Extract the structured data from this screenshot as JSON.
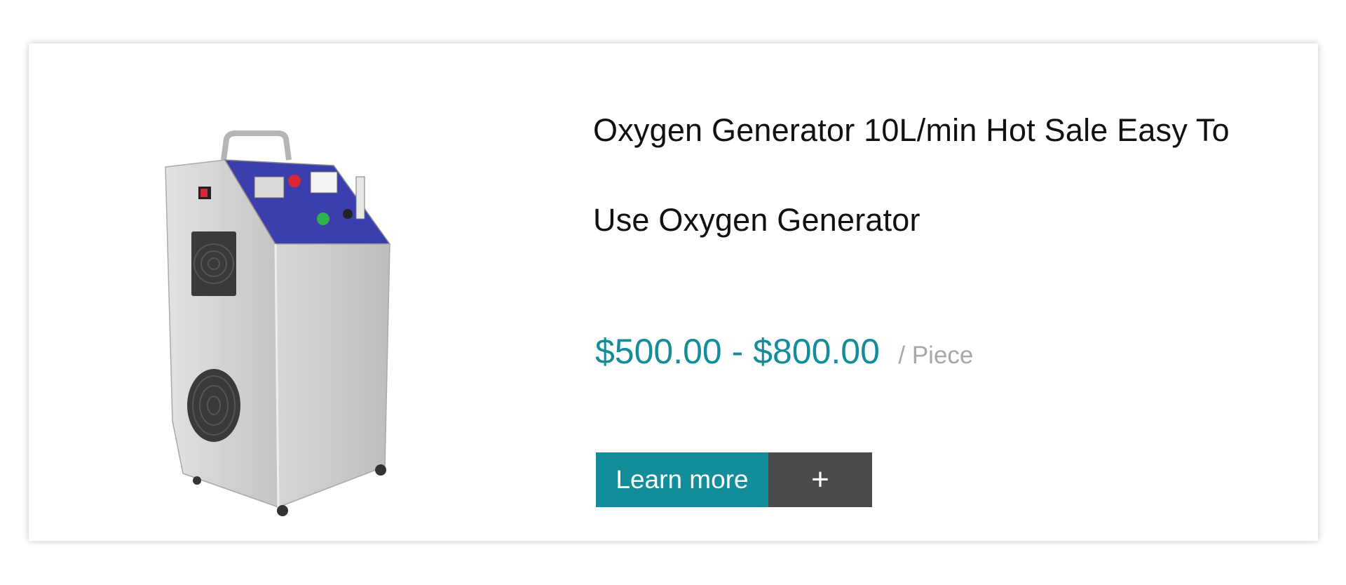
{
  "product": {
    "title": "Oxygen Generator 10L/min Hot Sale Easy To Use Oxygen Generator",
    "price_range": "$500.00 - $800.00",
    "unit": "/ Piece",
    "learn_more_label": "Learn more",
    "add_label": "+",
    "image_alt": "oxygen generator cabinet with blue control panel"
  },
  "colors": {
    "accent": "#138d9a",
    "secondary_button": "#4b4b4b",
    "panel_blue": "#3b3fae"
  }
}
